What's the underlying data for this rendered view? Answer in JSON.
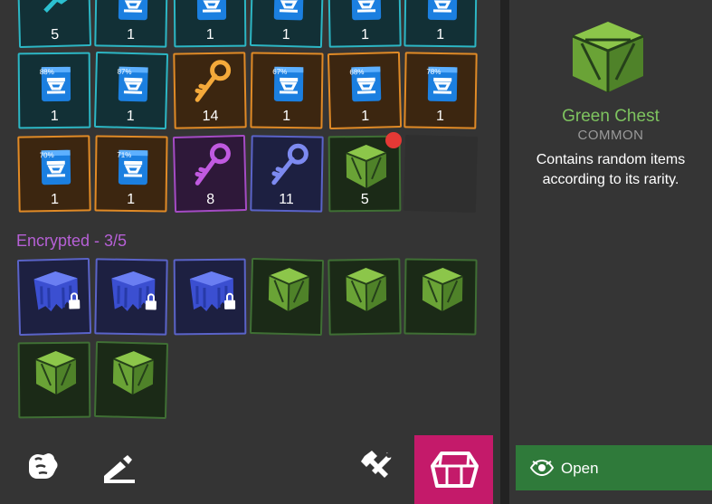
{
  "inventory": {
    "rows": [
      [
        {
          "kind": "hammer",
          "rarity": "teal",
          "count": "5"
        },
        {
          "kind": "chip",
          "rarity": "teal",
          "count": "1"
        },
        {
          "kind": "chip",
          "rarity": "teal",
          "count": "1"
        },
        {
          "kind": "chip",
          "rarity": "teal",
          "count": "1"
        },
        {
          "kind": "chip",
          "rarity": "teal",
          "count": "1"
        },
        {
          "kind": "chip",
          "rarity": "teal",
          "count": "1"
        }
      ],
      [
        {
          "kind": "chip",
          "rarity": "teal",
          "count": "1",
          "pct": "88%"
        },
        {
          "kind": "chip",
          "rarity": "teal",
          "count": "1",
          "pct": "87%"
        },
        {
          "kind": "key-orange",
          "rarity": "orange",
          "count": "14"
        },
        {
          "kind": "chip",
          "rarity": "orange",
          "count": "1",
          "pct": "67%"
        },
        {
          "kind": "chip",
          "rarity": "orange",
          "count": "1",
          "pct": "68%"
        },
        {
          "kind": "chip",
          "rarity": "orange",
          "count": "1",
          "pct": "78%"
        }
      ],
      [
        {
          "kind": "chip",
          "rarity": "orange",
          "count": "1",
          "pct": "70%"
        },
        {
          "kind": "chip",
          "rarity": "orange",
          "count": "1",
          "pct": "71%"
        },
        {
          "kind": "key-purple",
          "rarity": "purple",
          "count": "8"
        },
        {
          "kind": "key-blue",
          "rarity": "blue",
          "count": "11"
        },
        {
          "kind": "green-chest",
          "rarity": "green",
          "count": "5",
          "selected": true
        },
        {
          "kind": "empty",
          "rarity": "empty",
          "count": ""
        }
      ]
    ],
    "encrypted_label": "Encrypted - 3/5",
    "encrypted_rows": [
      [
        {
          "kind": "locked-crate",
          "rarity": "blue"
        },
        {
          "kind": "locked-crate",
          "rarity": "blue"
        },
        {
          "kind": "locked-crate",
          "rarity": "blue"
        },
        {
          "kind": "green-chest",
          "rarity": "green"
        },
        {
          "kind": "green-chest",
          "rarity": "green"
        },
        {
          "kind": "green-chest",
          "rarity": "green"
        }
      ],
      [
        {
          "kind": "green-chest",
          "rarity": "green"
        },
        {
          "kind": "green-chest",
          "rarity": "green"
        }
      ]
    ]
  },
  "toolbar": {
    "buttons": [
      "fist-icon",
      "edit-pen-icon",
      "tools-icon",
      "chest-tab-icon"
    ],
    "active": "chest-tab-icon"
  },
  "detail": {
    "name": "Green Chest",
    "rarity": "COMMON",
    "description": "Contains random items according to its rarity.",
    "open_label": "Open",
    "name_color": "#7ec35f"
  }
}
